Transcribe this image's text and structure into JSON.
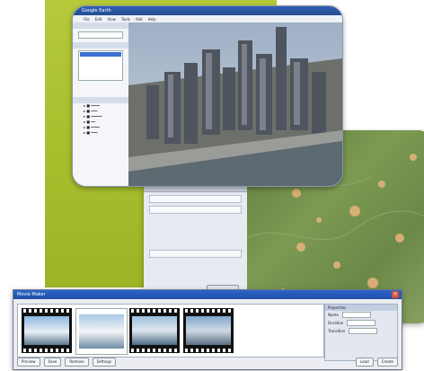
{
  "window1": {
    "title": "Google Earth",
    "menu": [
      "File",
      "Edit",
      "View",
      "Tools",
      "Add",
      "Help"
    ]
  },
  "window3": {
    "title": "Movie Maker",
    "props_head": "Properties",
    "props_rows": [
      "Name",
      "Duration",
      "Transition"
    ],
    "buttons": [
      "Preview",
      "Save",
      "Remove",
      "Settings",
      "Load",
      "Create"
    ]
  },
  "colors": {
    "accent_green": "#a6bd2c",
    "titlebar_blue": "#2f5fb0"
  }
}
